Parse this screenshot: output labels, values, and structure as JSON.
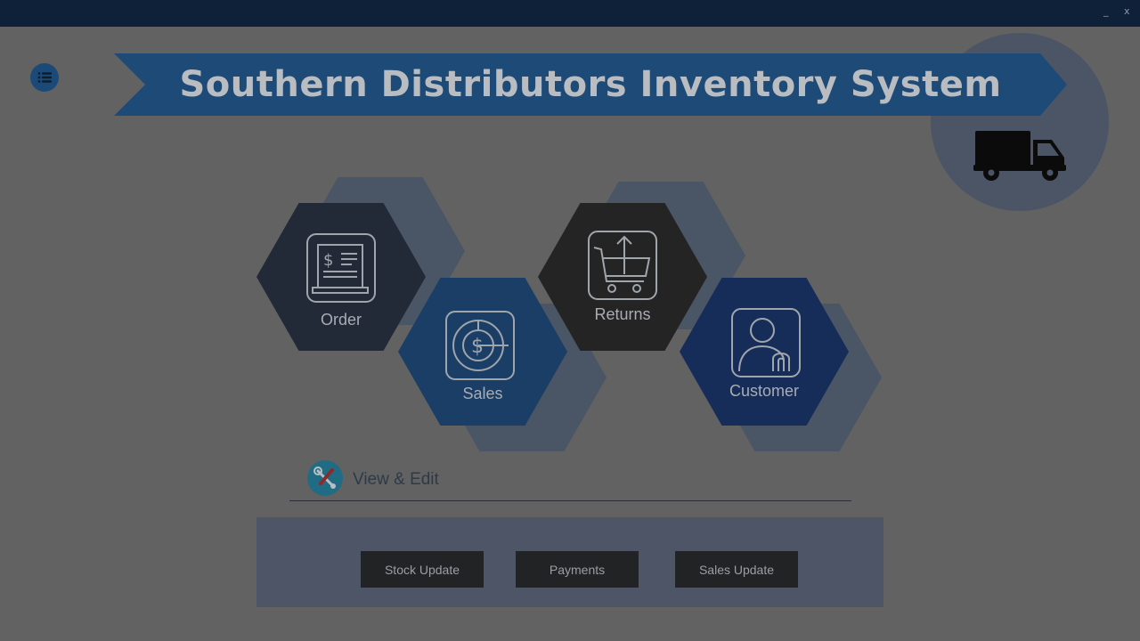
{
  "window": {
    "minimize_glyph": "_",
    "close_glyph": "x"
  },
  "header": {
    "title": "Southern Distributors Inventory System",
    "menu_icon": "list-menu-icon",
    "logo_icon": "truck-icon"
  },
  "tiles": {
    "order": {
      "label": "Order",
      "icon": "receipt-icon"
    },
    "sales": {
      "label": "Sales",
      "icon": "dollar-chart-icon"
    },
    "returns": {
      "label": "Returns",
      "icon": "cart-return-icon"
    },
    "customer": {
      "label": "Customer",
      "icon": "customer-icon"
    }
  },
  "view_edit": {
    "label": "View & Edit",
    "icon": "tools-icon"
  },
  "actions": [
    {
      "label": "Stock Update"
    },
    {
      "label": "Payments"
    },
    {
      "label": "Sales Update"
    }
  ],
  "colors": {
    "background": "#626262",
    "titlebar": "#0f2138",
    "banner": "#1d4a76",
    "tile_dark": "#222a38",
    "tile_blue": "#1a3e66",
    "tile_black": "#242424",
    "tile_navy": "#162d59",
    "tile_shadow": "#4a5566"
  }
}
